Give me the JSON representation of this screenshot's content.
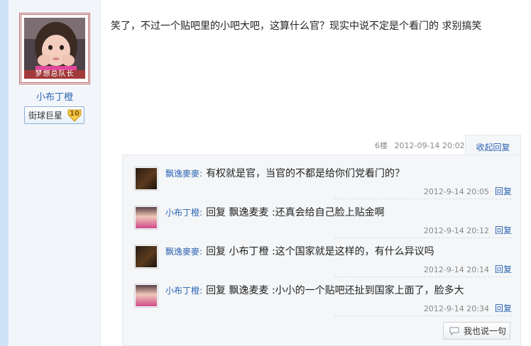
{
  "author": {
    "avatar_banner": "梦想总队长",
    "name": "小布丁橙",
    "badge_label": "街球巨星",
    "badge_level": "10"
  },
  "post": {
    "content": "笑了，不过一个贴吧里的小吧大吧，这算什么官？现实中说不定是个看门的 求别搞笑",
    "floor": "6楼",
    "time": "2012-09-14 20:02",
    "reply_toggle": "收起回复"
  },
  "replies": [
    {
      "user": "飘逸麥麥",
      "colon": ":",
      "text": "有权就是官，当官的不都是给你们党看门的？",
      "time": "2012-9-14 20:05",
      "reply_label": "回复",
      "avatar_icon": "dark-photo-avatar"
    },
    {
      "user": "小布丁橙",
      "colon": ":",
      "text": "回复 飘逸麦麦 :还真会给自己脸上贴金啊",
      "time": "2012-9-14 20:12",
      "reply_label": "回复",
      "avatar_icon": "girl-photo-avatar"
    },
    {
      "user": "飘逸麥麥",
      "colon": ":",
      "text": "回复 小布丁橙 :这个国家就是这样的，有什么异议吗",
      "time": "2012-9-14 20:14",
      "reply_label": "回复",
      "avatar_icon": "dark-photo-avatar"
    },
    {
      "user": "小布丁橙",
      "colon": ":",
      "text": "回复 飘逸麦麦 :小小的一个贴吧还扯到国家上面了，脸多大",
      "time": "2012-9-14 20:34",
      "reply_label": "回复",
      "avatar_icon": "girl-photo-avatar"
    }
  ],
  "say_button": "我也说一句",
  "colors": {
    "link": "#2d64b3",
    "panel_bg": "#f4f6f8",
    "left_col_bg": "#f2f6fb",
    "avatar_banner": "#a33a3a"
  }
}
